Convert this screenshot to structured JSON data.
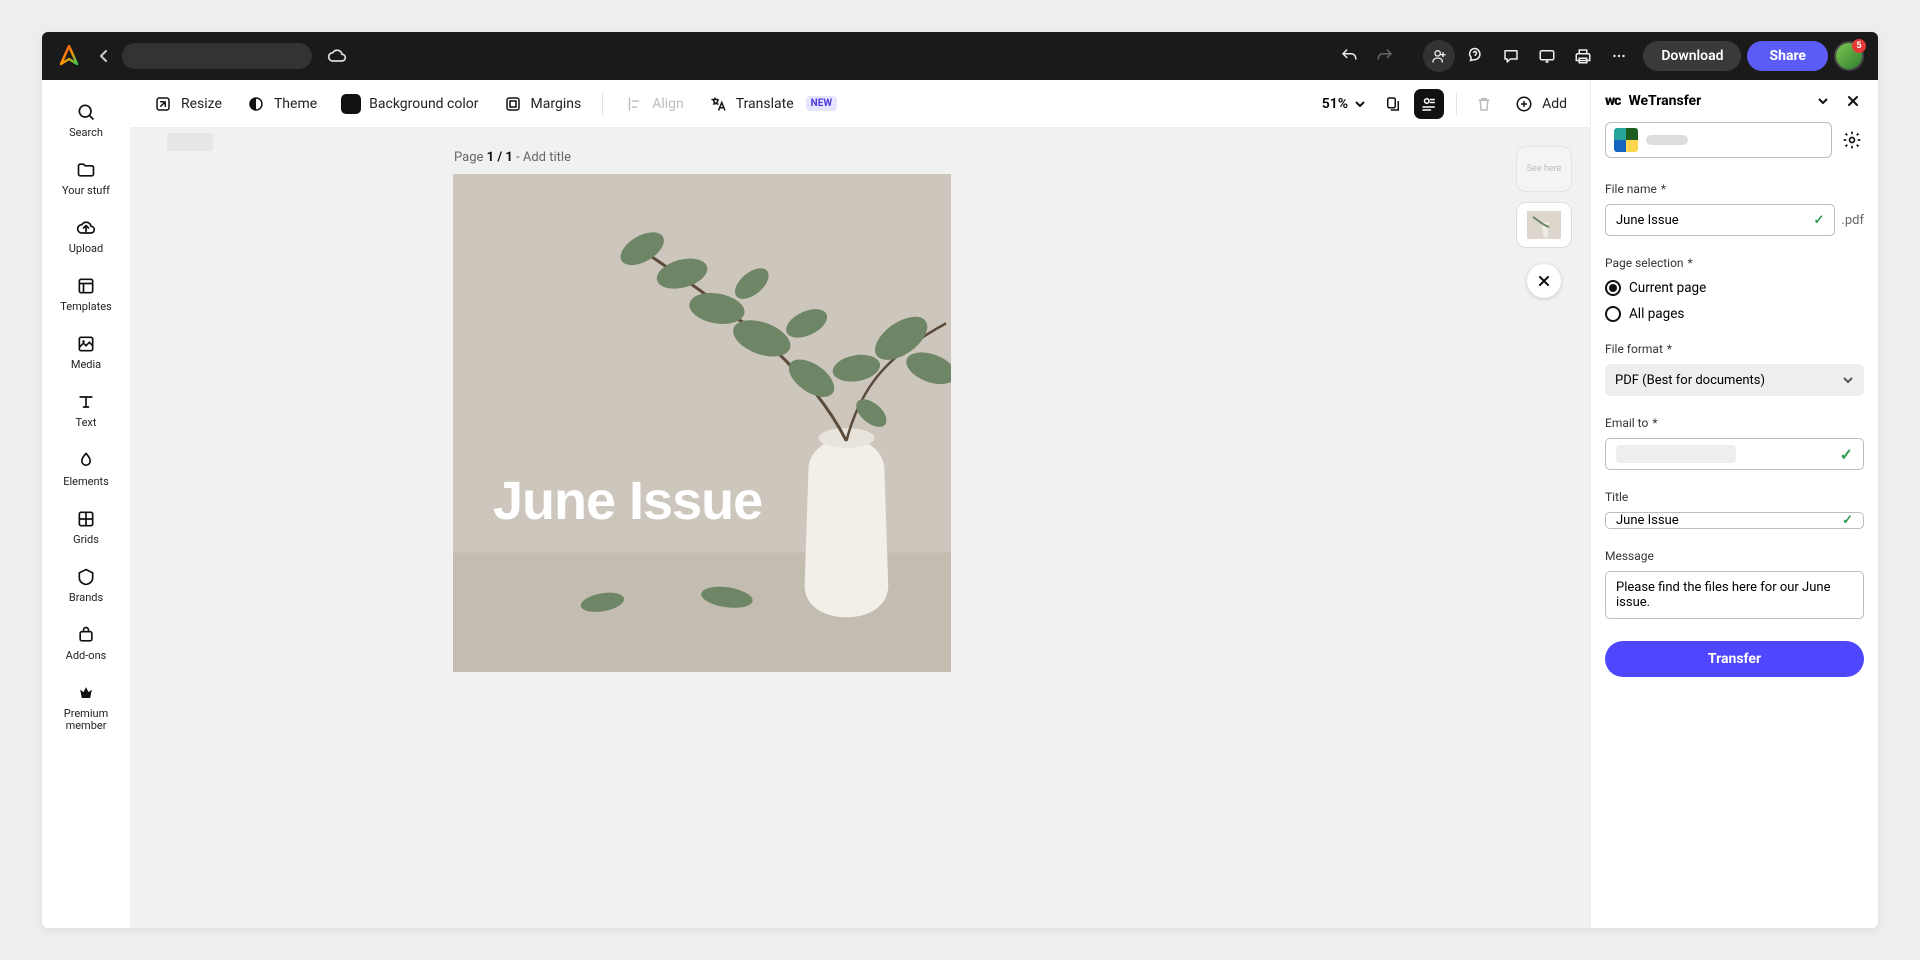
{
  "topbar": {
    "download_label": "Download",
    "share_label": "Share",
    "avatar_badge": "5"
  },
  "leftnav": {
    "items": [
      {
        "icon": "search",
        "label": "Search"
      },
      {
        "icon": "folder",
        "label": "Your stuff"
      },
      {
        "icon": "upload",
        "label": "Upload"
      },
      {
        "icon": "templates",
        "label": "Templates"
      },
      {
        "icon": "media",
        "label": "Media"
      },
      {
        "icon": "text",
        "label": "Text"
      },
      {
        "icon": "elements",
        "label": "Elements"
      },
      {
        "icon": "grids",
        "label": "Grids"
      },
      {
        "icon": "brands",
        "label": "Brands"
      },
      {
        "icon": "addons",
        "label": "Add-ons"
      },
      {
        "icon": "premium",
        "label": "Premium member"
      }
    ]
  },
  "contextbar": {
    "resize": "Resize",
    "theme": "Theme",
    "bgcolor": "Background color",
    "margins": "Margins",
    "align": "Align",
    "translate": "Translate",
    "new_badge": "NEW",
    "zoom": "51%",
    "add": "Add"
  },
  "canvas": {
    "page_prefix": "Page ",
    "page_bold": "1 / 1",
    "page_suffix": " - Add title",
    "artboard_title": "June Issue"
  },
  "panel": {
    "title": "WeTransfer",
    "file_name_label": "File name",
    "file_name_value": "June Issue",
    "file_ext": ".pdf",
    "page_sel_label": "Page selection",
    "current_page": "Current page",
    "all_pages": "All pages",
    "file_format_label": "File format",
    "file_format_value": "PDF (Best for documents)",
    "email_to_label": "Email to",
    "title_label": "Title",
    "title_value": "June Issue",
    "message_label": "Message",
    "message_value": "Please find the files here for our June issue.",
    "transfer_btn": "Transfer"
  }
}
